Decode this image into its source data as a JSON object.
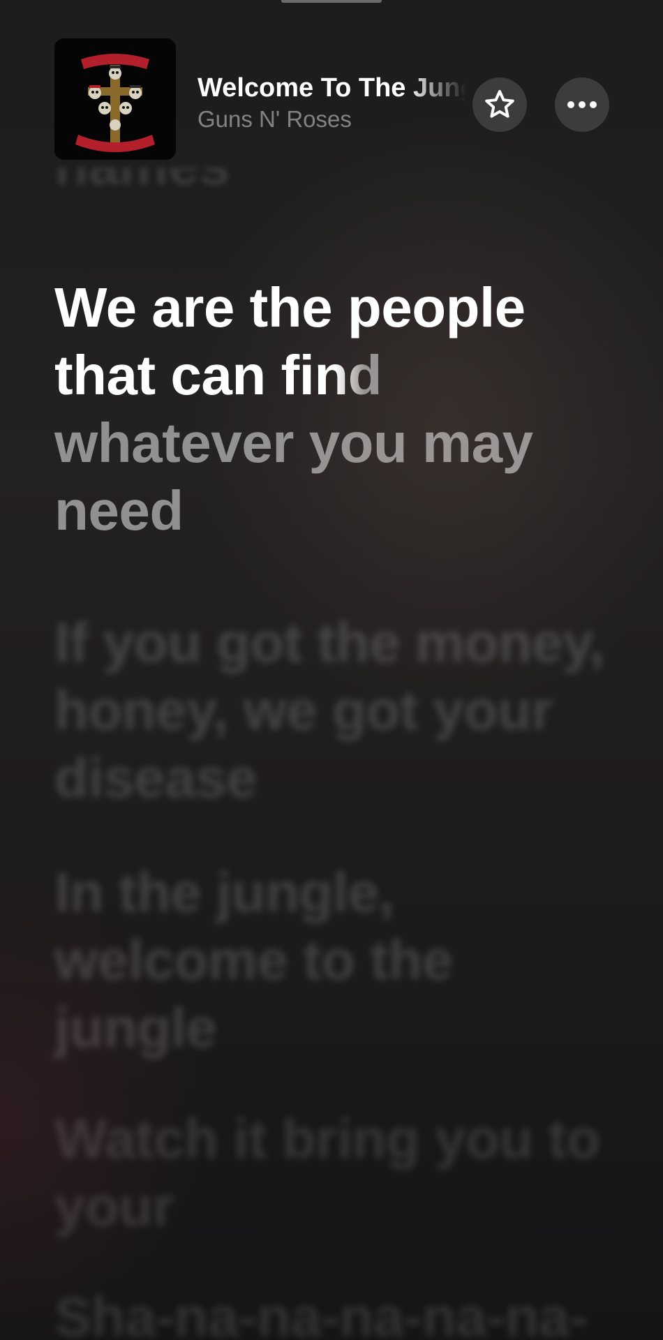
{
  "now_playing": {
    "title": "Welcome To The Jungle",
    "artist": "Guns N' Roses",
    "artwork": "album-artwork-cross-logo"
  },
  "controls": {
    "favorite_icon": "star-icon",
    "more_icon": "ellipsis-icon"
  },
  "lyrics": {
    "previous_partial": "names",
    "current": {
      "sung": "We are the people that can fi",
      "fading": "nd",
      "upcoming": " whatever you may need"
    },
    "upcoming_lines": [
      "If you got the money, honey, we got your disease",
      "In the jungle, welcome to the jungle",
      "Watch it bring you to your",
      "Sha-na-na-na-na-na-na-na"
    ]
  },
  "colors": {
    "background": "#1f1c1d",
    "active_lyric": "#ffffff",
    "inactive_lyric": "rgba(255,255,255,0.16)",
    "artwork_red": "#b3202b"
  }
}
